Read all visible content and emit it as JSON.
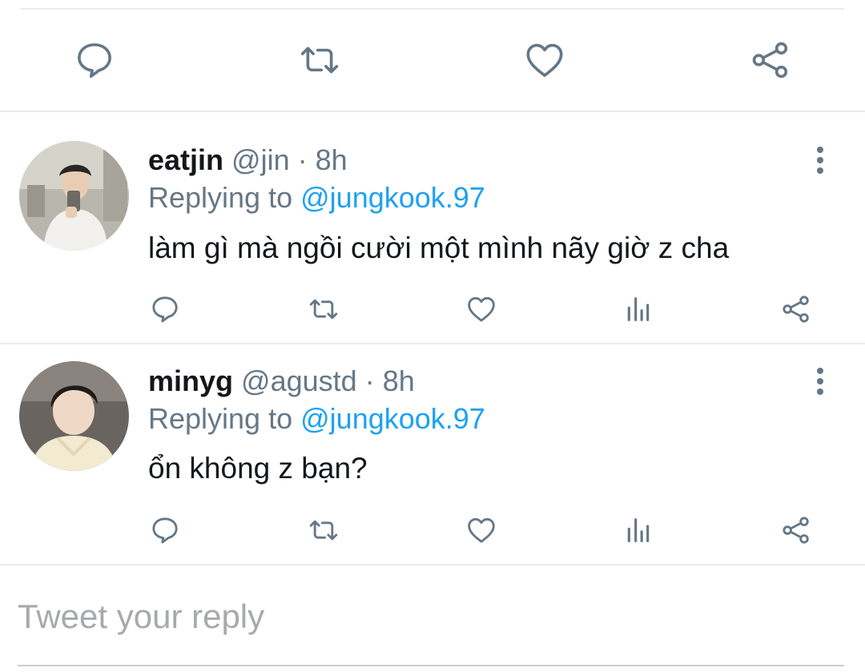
{
  "colors": {
    "icon": "#657786",
    "accent": "#1da1f2",
    "text": "#14171a",
    "muted": "#657786",
    "divider": "#e6ecf0",
    "placeholder": "#a7a9ab"
  },
  "main_actions": [
    {
      "name": "reply",
      "icon": "comment-icon"
    },
    {
      "name": "retweet",
      "icon": "retweet-icon"
    },
    {
      "name": "like",
      "icon": "heart-icon"
    },
    {
      "name": "share",
      "icon": "share-icon"
    }
  ],
  "replies": [
    {
      "display_name": "eatjin",
      "handle": "@jin",
      "separator": "·",
      "time": "8h",
      "replying_prefix": "Replying to",
      "replying_to": "@jungkook.97",
      "text": "làm gì mà ngồi cười một mình nãy giờ z cha",
      "avatar": "avatar-photo"
    },
    {
      "display_name": "minyg",
      "handle": "@agustd",
      "separator": "·",
      "time": "8h",
      "replying_prefix": "Replying to",
      "replying_to": "@jungkook.97",
      "text": "ổn không z bạn?",
      "avatar": "avatar-photo"
    }
  ],
  "reply_actions": [
    "comment-icon",
    "retweet-icon",
    "heart-icon",
    "analytics-icon",
    "share-icon"
  ],
  "composer": {
    "placeholder": "Tweet your reply"
  }
}
